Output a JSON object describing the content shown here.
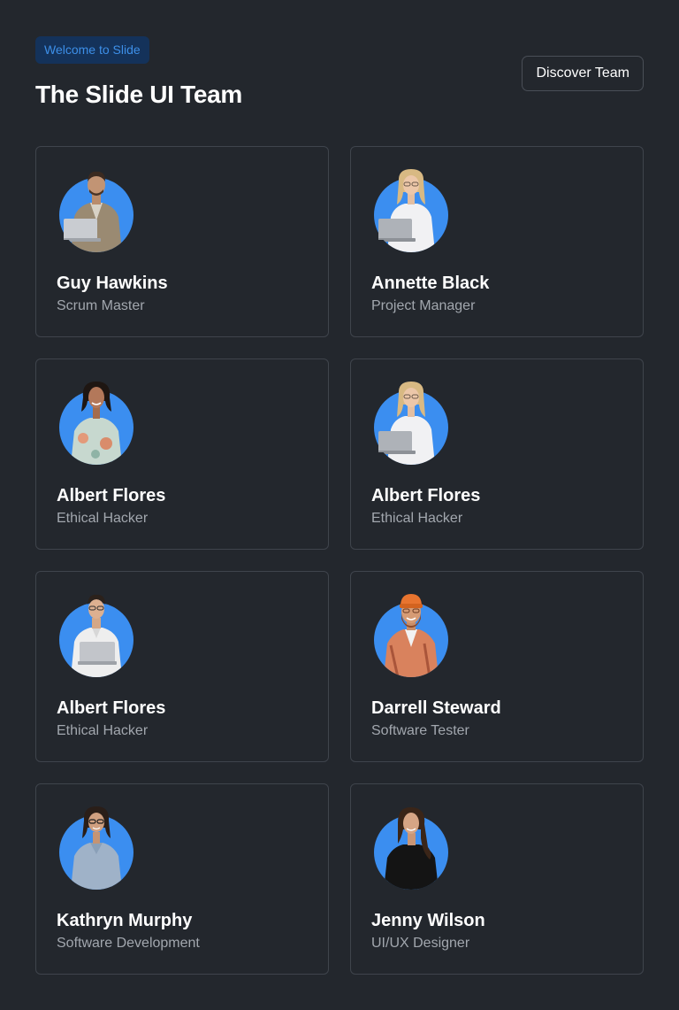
{
  "header": {
    "badge": "Welcome to Slide",
    "title": "The Slide UI Team",
    "discover_label": "Discover Team"
  },
  "colors": {
    "background": "#23272d",
    "card_border": "#3f444c",
    "accent_blue": "#3b8ef0",
    "badge_bg": "#14325a",
    "badge_text": "#3d8fe8",
    "role_text": "#a2a7ae"
  },
  "team": [
    {
      "name": "Guy Hawkins",
      "role": "Scrum Master",
      "avatar": "man-with-laptop-avatar"
    },
    {
      "name": "Annette Black",
      "role": "Project Manager",
      "avatar": "blonde-woman-with-laptop-avatar"
    },
    {
      "name": "Albert Flores",
      "role": "Ethical Hacker",
      "avatar": "smiling-woman-floral-shirt-avatar"
    },
    {
      "name": "Albert Flores",
      "role": "Ethical Hacker",
      "avatar": "blonde-woman-with-laptop-avatar"
    },
    {
      "name": "Albert Flores",
      "role": "Ethical Hacker",
      "avatar": "man-white-shirt-laptop-avatar"
    },
    {
      "name": "Darrell Steward",
      "role": "Software Tester",
      "avatar": "bearded-man-orange-beanie-avatar"
    },
    {
      "name": "Kathryn Murphy",
      "role": "Software Development",
      "avatar": "woman-glasses-denim-shirt-avatar"
    },
    {
      "name": "Jenny Wilson",
      "role": "UI/UX Designer",
      "avatar": "woman-black-shirt-avatar"
    }
  ]
}
